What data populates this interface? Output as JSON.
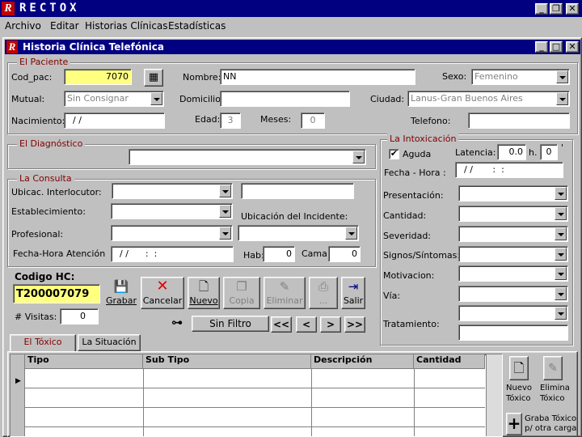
{
  "app": {
    "logo": "R",
    "title": "RECTOX"
  },
  "menu": [
    "Archivo",
    "Editar",
    "Historias Clínicas",
    "Estadísticas"
  ],
  "window": {
    "logo": "R",
    "title": "Historia Clínica Telefónica"
  },
  "paciente": {
    "group_title": "El Paciente",
    "cod_pac_label": "Cod_pac:",
    "cod_pac_value": "7070",
    "nombre_label": "Nombre:",
    "nombre_value": "NN",
    "sexo_label": "Sexo:",
    "sexo_value": "Femenino",
    "mutual_label": "Mutual:",
    "mutual_value": "Sin Consignar",
    "domicilio_label": "Domicilio:",
    "domicilio_value": "",
    "ciudad_label": "Ciudad:",
    "ciudad_value": "Lanus-Gran Buenos Aires",
    "nacimiento_label": "Nacimiento:",
    "nacimiento_value": "/ /",
    "edad_label": "Edad:",
    "edad_value": "3",
    "meses_label": "Meses:",
    "meses_value": "0",
    "telefono_label": "Telefono:",
    "telefono_value": ""
  },
  "diagnostico": {
    "group_title": "El Diagnóstico",
    "value": ""
  },
  "consulta": {
    "group_title": "La Consulta",
    "interlocutor_label": "Ubicac. Interlocutor:",
    "establecimiento_label": "Establecimiento:",
    "ubicacion_label": "Ubicación del Incidente:",
    "profesional_label": "Profesional:",
    "fecha_label": "Fecha-Hora Atención",
    "fecha_value": "/ /      :  :",
    "hab_label": "Hab:",
    "hab_value": "0",
    "cama_label": "Cama:",
    "cama_value": "0"
  },
  "intoxicacion": {
    "group_title": "La Intoxicación",
    "aguda_label": "Aguda",
    "aguda_checked": true,
    "latencia_label": "Latencia:",
    "latencia_value": "0.0",
    "h_label": "h.",
    "min_value": "0",
    "min_suffix": "'",
    "fecha_label": "Fecha - Hora :",
    "fecha_value": "/ /       :  :",
    "presentacion_label": "Presentación:",
    "cantidad_label": "Cantidad:",
    "severidad_label": "Severidad:",
    "signos_label": "Signos/Síntomas:",
    "motivacion_label": "Motivacion:",
    "via_label": "Vía:",
    "tratamiento_label": "Tratamiento:"
  },
  "codigo": {
    "label": "Codigo HC:",
    "value": "T200007079",
    "visitas_label": "# Visitas:",
    "visitas_value": "0"
  },
  "toolbar": {
    "grabar": "Grabar",
    "cancelar": "Cancelar",
    "nuevo": "Nuevo",
    "copia": "Copia",
    "eliminar": "Eliminar",
    "print": "...",
    "salir": "Salir",
    "sin_filtro": "Sin Filtro",
    "first": "<<",
    "prev": "<",
    "next": ">",
    "last": ">>"
  },
  "tabs": [
    "El Tóxico",
    "La Situación"
  ],
  "grid": {
    "columns": [
      "Tipo",
      "Sub Tipo",
      "Descripción",
      "Cantidad"
    ]
  },
  "side": {
    "nuevo_toxico": "Nuevo Tóxico",
    "elimina_toxico": "Elimina Tóxico",
    "graba_toxico": "Graba Tóxico p/ otra carga"
  },
  "colors": {
    "titlebar": "#000080",
    "logo": "#c00000",
    "highlight": "#ffff80",
    "group_title": "#800000"
  }
}
